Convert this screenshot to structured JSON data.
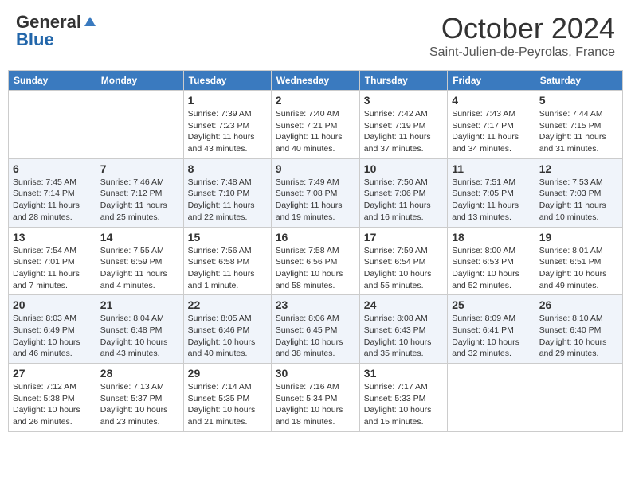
{
  "header": {
    "logo_general": "General",
    "logo_blue": "Blue",
    "month": "October 2024",
    "location": "Saint-Julien-de-Peyrolas, France"
  },
  "days_of_week": [
    "Sunday",
    "Monday",
    "Tuesday",
    "Wednesday",
    "Thursday",
    "Friday",
    "Saturday"
  ],
  "weeks": [
    [
      {
        "day": "",
        "sunrise": "",
        "sunset": "",
        "daylight": ""
      },
      {
        "day": "",
        "sunrise": "",
        "sunset": "",
        "daylight": ""
      },
      {
        "day": "1",
        "sunrise": "Sunrise: 7:39 AM",
        "sunset": "Sunset: 7:23 PM",
        "daylight": "Daylight: 11 hours and 43 minutes."
      },
      {
        "day": "2",
        "sunrise": "Sunrise: 7:40 AM",
        "sunset": "Sunset: 7:21 PM",
        "daylight": "Daylight: 11 hours and 40 minutes."
      },
      {
        "day": "3",
        "sunrise": "Sunrise: 7:42 AM",
        "sunset": "Sunset: 7:19 PM",
        "daylight": "Daylight: 11 hours and 37 minutes."
      },
      {
        "day": "4",
        "sunrise": "Sunrise: 7:43 AM",
        "sunset": "Sunset: 7:17 PM",
        "daylight": "Daylight: 11 hours and 34 minutes."
      },
      {
        "day": "5",
        "sunrise": "Sunrise: 7:44 AM",
        "sunset": "Sunset: 7:15 PM",
        "daylight": "Daylight: 11 hours and 31 minutes."
      }
    ],
    [
      {
        "day": "6",
        "sunrise": "Sunrise: 7:45 AM",
        "sunset": "Sunset: 7:14 PM",
        "daylight": "Daylight: 11 hours and 28 minutes."
      },
      {
        "day": "7",
        "sunrise": "Sunrise: 7:46 AM",
        "sunset": "Sunset: 7:12 PM",
        "daylight": "Daylight: 11 hours and 25 minutes."
      },
      {
        "day": "8",
        "sunrise": "Sunrise: 7:48 AM",
        "sunset": "Sunset: 7:10 PM",
        "daylight": "Daylight: 11 hours and 22 minutes."
      },
      {
        "day": "9",
        "sunrise": "Sunrise: 7:49 AM",
        "sunset": "Sunset: 7:08 PM",
        "daylight": "Daylight: 11 hours and 19 minutes."
      },
      {
        "day": "10",
        "sunrise": "Sunrise: 7:50 AM",
        "sunset": "Sunset: 7:06 PM",
        "daylight": "Daylight: 11 hours and 16 minutes."
      },
      {
        "day": "11",
        "sunrise": "Sunrise: 7:51 AM",
        "sunset": "Sunset: 7:05 PM",
        "daylight": "Daylight: 11 hours and 13 minutes."
      },
      {
        "day": "12",
        "sunrise": "Sunrise: 7:53 AM",
        "sunset": "Sunset: 7:03 PM",
        "daylight": "Daylight: 11 hours and 10 minutes."
      }
    ],
    [
      {
        "day": "13",
        "sunrise": "Sunrise: 7:54 AM",
        "sunset": "Sunset: 7:01 PM",
        "daylight": "Daylight: 11 hours and 7 minutes."
      },
      {
        "day": "14",
        "sunrise": "Sunrise: 7:55 AM",
        "sunset": "Sunset: 6:59 PM",
        "daylight": "Daylight: 11 hours and 4 minutes."
      },
      {
        "day": "15",
        "sunrise": "Sunrise: 7:56 AM",
        "sunset": "Sunset: 6:58 PM",
        "daylight": "Daylight: 11 hours and 1 minute."
      },
      {
        "day": "16",
        "sunrise": "Sunrise: 7:58 AM",
        "sunset": "Sunset: 6:56 PM",
        "daylight": "Daylight: 10 hours and 58 minutes."
      },
      {
        "day": "17",
        "sunrise": "Sunrise: 7:59 AM",
        "sunset": "Sunset: 6:54 PM",
        "daylight": "Daylight: 10 hours and 55 minutes."
      },
      {
        "day": "18",
        "sunrise": "Sunrise: 8:00 AM",
        "sunset": "Sunset: 6:53 PM",
        "daylight": "Daylight: 10 hours and 52 minutes."
      },
      {
        "day": "19",
        "sunrise": "Sunrise: 8:01 AM",
        "sunset": "Sunset: 6:51 PM",
        "daylight": "Daylight: 10 hours and 49 minutes."
      }
    ],
    [
      {
        "day": "20",
        "sunrise": "Sunrise: 8:03 AM",
        "sunset": "Sunset: 6:49 PM",
        "daylight": "Daylight: 10 hours and 46 minutes."
      },
      {
        "day": "21",
        "sunrise": "Sunrise: 8:04 AM",
        "sunset": "Sunset: 6:48 PM",
        "daylight": "Daylight: 10 hours and 43 minutes."
      },
      {
        "day": "22",
        "sunrise": "Sunrise: 8:05 AM",
        "sunset": "Sunset: 6:46 PM",
        "daylight": "Daylight: 10 hours and 40 minutes."
      },
      {
        "day": "23",
        "sunrise": "Sunrise: 8:06 AM",
        "sunset": "Sunset: 6:45 PM",
        "daylight": "Daylight: 10 hours and 38 minutes."
      },
      {
        "day": "24",
        "sunrise": "Sunrise: 8:08 AM",
        "sunset": "Sunset: 6:43 PM",
        "daylight": "Daylight: 10 hours and 35 minutes."
      },
      {
        "day": "25",
        "sunrise": "Sunrise: 8:09 AM",
        "sunset": "Sunset: 6:41 PM",
        "daylight": "Daylight: 10 hours and 32 minutes."
      },
      {
        "day": "26",
        "sunrise": "Sunrise: 8:10 AM",
        "sunset": "Sunset: 6:40 PM",
        "daylight": "Daylight: 10 hours and 29 minutes."
      }
    ],
    [
      {
        "day": "27",
        "sunrise": "Sunrise: 7:12 AM",
        "sunset": "Sunset: 5:38 PM",
        "daylight": "Daylight: 10 hours and 26 minutes."
      },
      {
        "day": "28",
        "sunrise": "Sunrise: 7:13 AM",
        "sunset": "Sunset: 5:37 PM",
        "daylight": "Daylight: 10 hours and 23 minutes."
      },
      {
        "day": "29",
        "sunrise": "Sunrise: 7:14 AM",
        "sunset": "Sunset: 5:35 PM",
        "daylight": "Daylight: 10 hours and 21 minutes."
      },
      {
        "day": "30",
        "sunrise": "Sunrise: 7:16 AM",
        "sunset": "Sunset: 5:34 PM",
        "daylight": "Daylight: 10 hours and 18 minutes."
      },
      {
        "day": "31",
        "sunrise": "Sunrise: 7:17 AM",
        "sunset": "Sunset: 5:33 PM",
        "daylight": "Daylight: 10 hours and 15 minutes."
      },
      {
        "day": "",
        "sunrise": "",
        "sunset": "",
        "daylight": ""
      },
      {
        "day": "",
        "sunrise": "",
        "sunset": "",
        "daylight": ""
      }
    ]
  ]
}
